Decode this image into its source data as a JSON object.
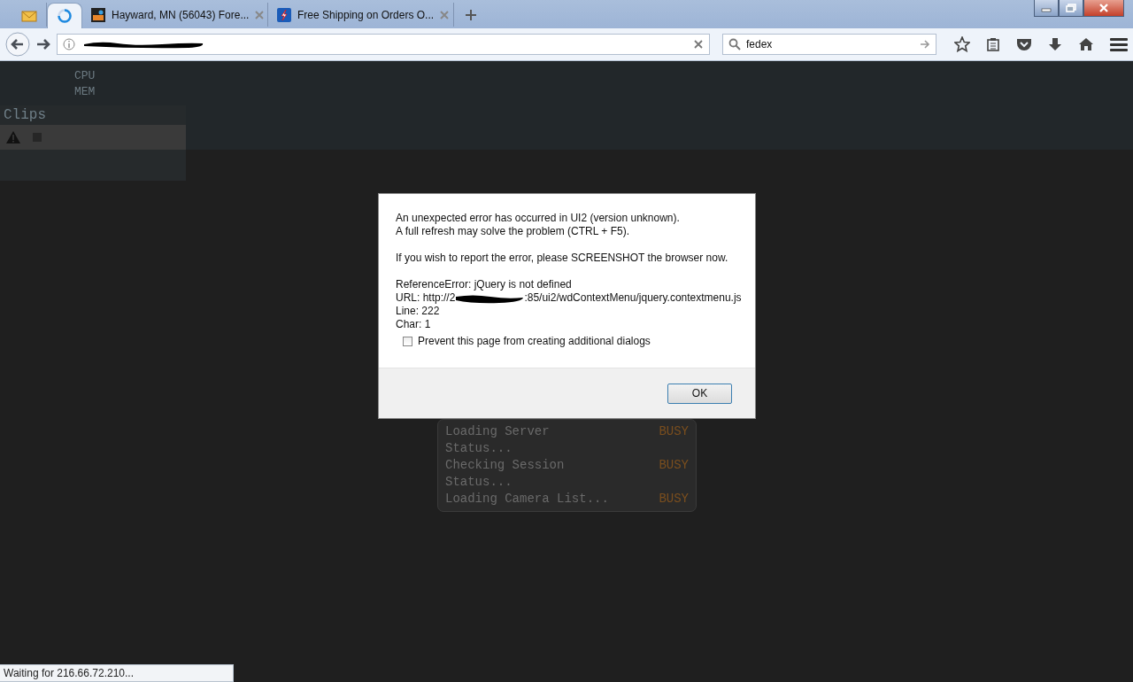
{
  "browser": {
    "tabs": [
      {
        "kind": "pinned",
        "selected": false
      },
      {
        "kind": "loading",
        "selected": true
      },
      {
        "kind": "page",
        "title": "Hayward, MN (56043) Fore...",
        "selected": false
      },
      {
        "kind": "page",
        "title": "Free Shipping on Orders O...",
        "selected": false
      }
    ],
    "search": {
      "value": "fedex"
    }
  },
  "app": {
    "stats": [
      "CPU",
      "MEM"
    ],
    "panel_title": "Clips",
    "loading": [
      {
        "label": "Loading Server Status...",
        "status": "BUSY"
      },
      {
        "label": "Checking Session Status...",
        "status": "BUSY"
      },
      {
        "label": "Loading Camera List...",
        "status": "BUSY"
      }
    ]
  },
  "dialog": {
    "lines": [
      "An unexpected error has occurred in UI2 (version unknown).",
      "A full refresh may solve the problem (CTRL + F5)."
    ],
    "report": "If you wish to report the error, please SCREENSHOT the browser now.",
    "error": "ReferenceError: jQuery is not defined",
    "url_prefix": "URL: http://2",
    "url_suffix": ":85/ui2/wdContextMenu/jquery.contextmenu.js",
    "line": "Line: 222",
    "char": "Char: 1",
    "checkbox": {
      "label": "Prevent this page from creating additional dialogs",
      "checked": false
    },
    "button": "OK"
  },
  "status_bar": "Waiting for 216.66.72.210..."
}
